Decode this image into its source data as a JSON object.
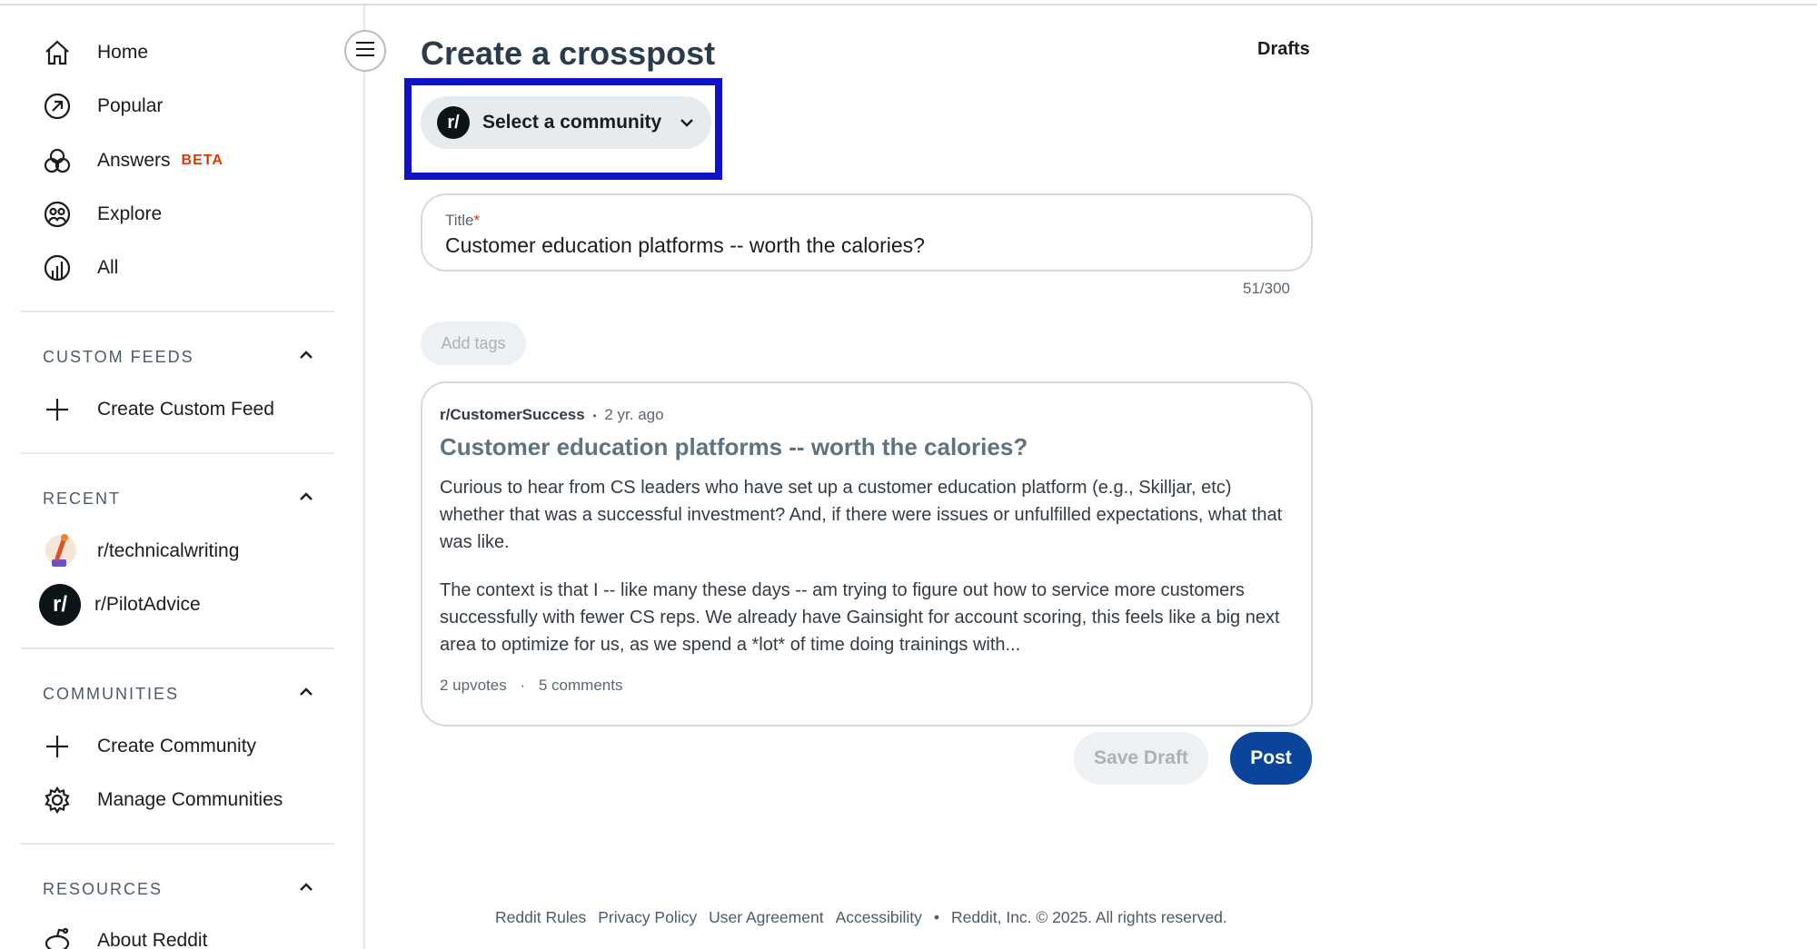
{
  "sidebar": {
    "nav": [
      {
        "label": "Home",
        "icon": "home-icon"
      },
      {
        "label": "Popular",
        "icon": "popular-icon"
      },
      {
        "label": "Answers",
        "icon": "answers-icon",
        "badge": "BETA"
      },
      {
        "label": "Explore",
        "icon": "explore-icon"
      },
      {
        "label": "All",
        "icon": "all-icon"
      }
    ],
    "custom_feeds": {
      "heading": "CUSTOM FEEDS",
      "create_label": "Create Custom Feed"
    },
    "recent": {
      "heading": "RECENT",
      "items": [
        {
          "label": "r/technicalwriting"
        },
        {
          "label": "r/PilotAdvice"
        }
      ]
    },
    "communities": {
      "heading": "COMMUNITIES",
      "create_label": "Create Community",
      "manage_label": "Manage Communities"
    },
    "resources": {
      "heading": "RESOURCES",
      "about_label": "About Reddit"
    }
  },
  "main": {
    "title": "Create a crosspost",
    "drafts_label": "Drafts",
    "community_select": {
      "label": "Select a community",
      "logo_text": "r/"
    },
    "title_field": {
      "label": "Title",
      "required_marker": "*",
      "value": "Customer education platforms -- worth the calories?",
      "counter": "51/300"
    },
    "add_tags_label": "Add tags",
    "preview": {
      "subreddit": "r/CustomerSuccess",
      "separator": "•",
      "age": "2 yr. ago",
      "title": "Customer education platforms -- worth the calories?",
      "paragraphs": [
        "Curious to hear from CS leaders who have set up a customer education platform (e.g., Skilljar, etc) whether that was a successful investment? And, if there were issues or unfulfilled expectations, what that was like.",
        "The context is that I -- like many these days -- am trying to figure out how to service more customers successfully with fewer CS reps. We already have Gainsight for account scoring, this feels like a big next area to optimize for us, as we spend a *lot* of time doing trainings with..."
      ],
      "upvotes": "2 upvotes",
      "dot": "·",
      "comments": "5 comments"
    },
    "save_draft_label": "Save Draft",
    "post_label": "Post"
  },
  "footer": {
    "links": [
      "Reddit Rules",
      "Privacy Policy",
      "User Agreement",
      "Accessibility"
    ],
    "bullet": "•",
    "copyright": "Reddit, Inc. © 2025. All rights reserved."
  },
  "colors": {
    "highlight": "#1111c8",
    "post_button": "#0a449b",
    "beta": "#d93900"
  }
}
